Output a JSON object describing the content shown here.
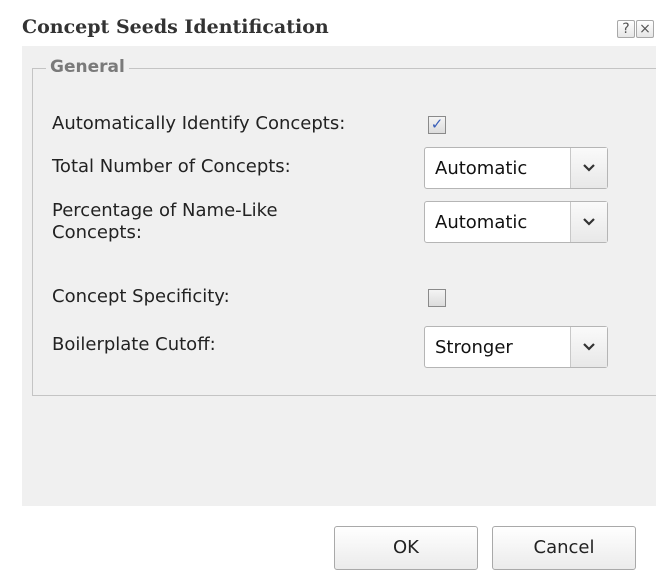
{
  "dialog": {
    "title": "Concept Seeds Identification",
    "help_label": "?",
    "close_label": "×"
  },
  "group": {
    "legend": "General",
    "rows": {
      "auto_identify": {
        "label": "Automatically Identify Concepts:",
        "checked": true
      },
      "total_number": {
        "label": "Total Number of Concepts:",
        "value": "Automatic"
      },
      "percentage_name_like": {
        "label_line1": "Percentage of Name-Like",
        "label_line2": "Concepts:",
        "value": "Automatic"
      },
      "specificity": {
        "label": "Concept Specificity:",
        "checked": false
      },
      "boilerplate": {
        "label": "Boilerplate Cutoff:",
        "value": "Stronger"
      }
    }
  },
  "buttons": {
    "ok": "OK",
    "cancel": "Cancel"
  },
  "colors": {
    "body_bg": "#f0f0f0",
    "check_color": "#3a5fb8"
  },
  "icons": {
    "help": "help-icon",
    "close": "close-icon",
    "dropdown": "chevron-down-icon",
    "checkmark": "checkmark-icon"
  }
}
